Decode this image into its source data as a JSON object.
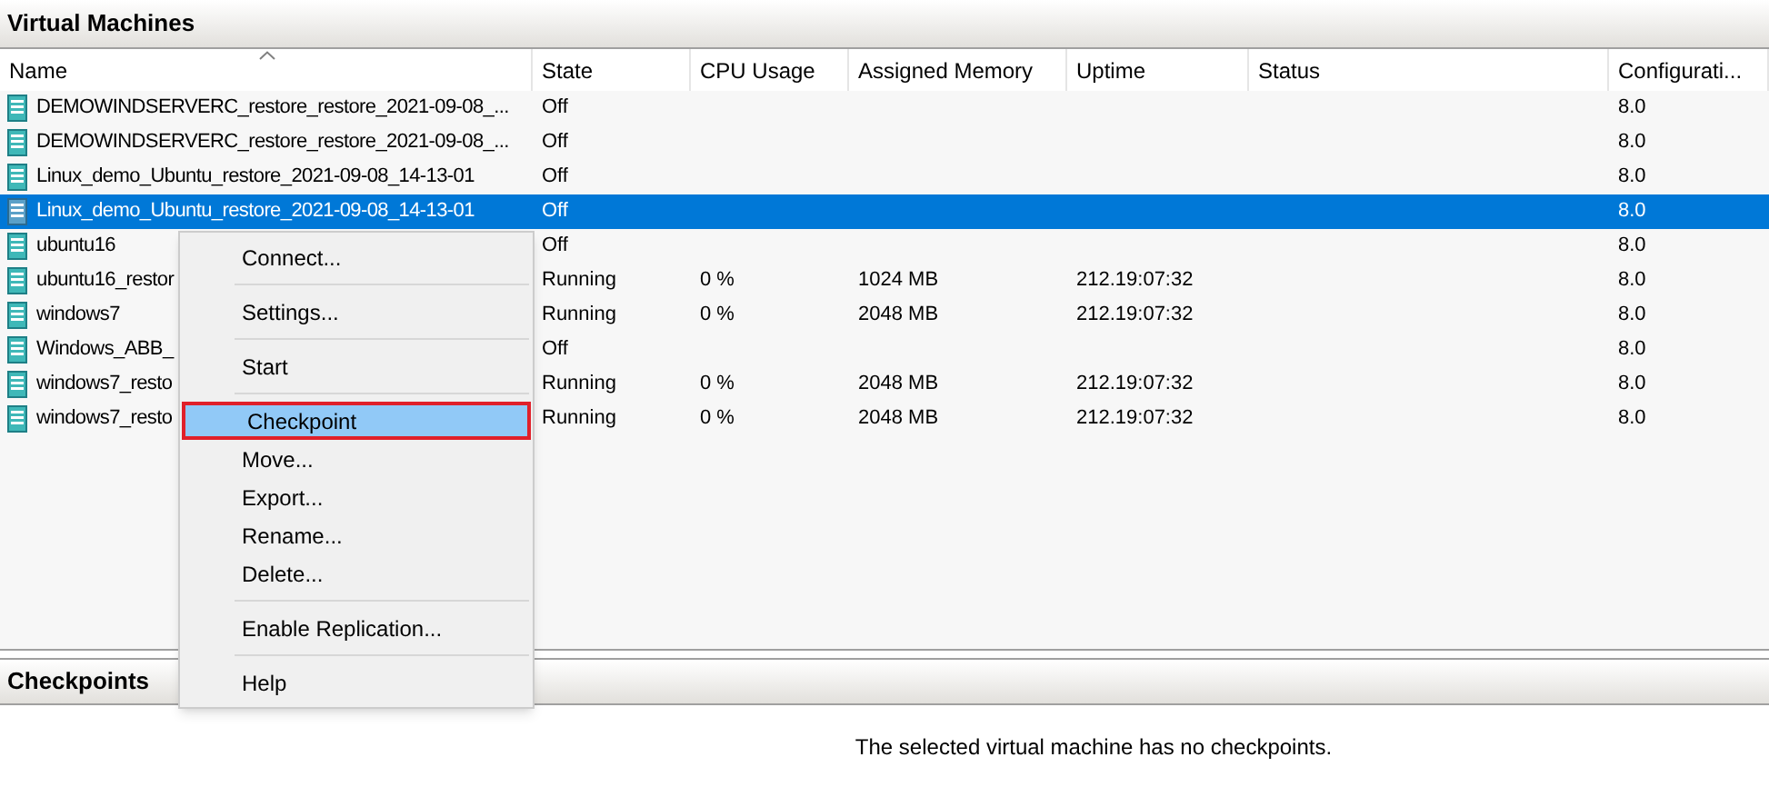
{
  "vm_panel": {
    "title": "Virtual Machines"
  },
  "table": {
    "columns": [
      "Name",
      "State",
      "CPU Usage",
      "Assigned Memory",
      "Uptime",
      "Status",
      "Configurati..."
    ],
    "rows": [
      {
        "cells": [
          "DEMOWINDSERVERC_restore_restore_2021-09-08_...",
          "Off",
          "",
          "",
          "",
          "",
          "8.0"
        ],
        "selected": false
      },
      {
        "cells": [
          "DEMOWINDSERVERC_restore_restore_2021-09-08_...",
          "Off",
          "",
          "",
          "",
          "",
          "8.0"
        ],
        "selected": false
      },
      {
        "cells": [
          "Linux_demo_Ubuntu_restore_2021-09-08_14-13-01",
          "Off",
          "",
          "",
          "",
          "",
          "8.0"
        ],
        "selected": false
      },
      {
        "cells": [
          "Linux_demo_Ubuntu_restore_2021-09-08_14-13-01",
          "Off",
          "",
          "",
          "",
          "",
          "8.0"
        ],
        "selected": true
      },
      {
        "cells": [
          "ubuntu16",
          "Off",
          "",
          "",
          "",
          "",
          "8.0"
        ],
        "selected": false
      },
      {
        "cells": [
          "ubuntu16_restor",
          "Running",
          "0 %",
          "1024 MB",
          "212.19:07:32",
          "",
          "8.0"
        ],
        "selected": false
      },
      {
        "cells": [
          "windows7",
          "Running",
          "0 %",
          "2048 MB",
          "212.19:07:32",
          "",
          "8.0"
        ],
        "selected": false
      },
      {
        "cells": [
          "Windows_ABB_",
          "Off",
          "",
          "",
          "",
          "",
          "8.0"
        ],
        "selected": false
      },
      {
        "cells": [
          "windows7_resto",
          "Running",
          "0 %",
          "2048 MB",
          "212.19:07:32",
          "",
          "8.0"
        ],
        "selected": false
      },
      {
        "cells": [
          "windows7_resto",
          "Running",
          "0 %",
          "2048 MB",
          "212.19:07:32",
          "",
          "8.0"
        ],
        "selected": false
      }
    ]
  },
  "context_menu": {
    "items": [
      {
        "kind": "item",
        "label": "Connect...",
        "selected": false
      },
      {
        "kind": "separator"
      },
      {
        "kind": "item",
        "label": "Settings...",
        "selected": false
      },
      {
        "kind": "separator"
      },
      {
        "kind": "item",
        "label": "Start",
        "selected": false
      },
      {
        "kind": "separator"
      },
      {
        "kind": "item",
        "label": "Checkpoint",
        "selected": true
      },
      {
        "kind": "item",
        "label": "Move...",
        "selected": false
      },
      {
        "kind": "item",
        "label": "Export...",
        "selected": false
      },
      {
        "kind": "item",
        "label": "Rename...",
        "selected": false
      },
      {
        "kind": "item",
        "label": "Delete...",
        "selected": false
      },
      {
        "kind": "separator"
      },
      {
        "kind": "item",
        "label": "Enable Replication...",
        "selected": false
      },
      {
        "kind": "separator"
      },
      {
        "kind": "item",
        "label": "Help",
        "selected": false
      }
    ]
  },
  "checkpoints_panel": {
    "title": "Checkpoints",
    "message": "The selected virtual machine has no checkpoints."
  }
}
